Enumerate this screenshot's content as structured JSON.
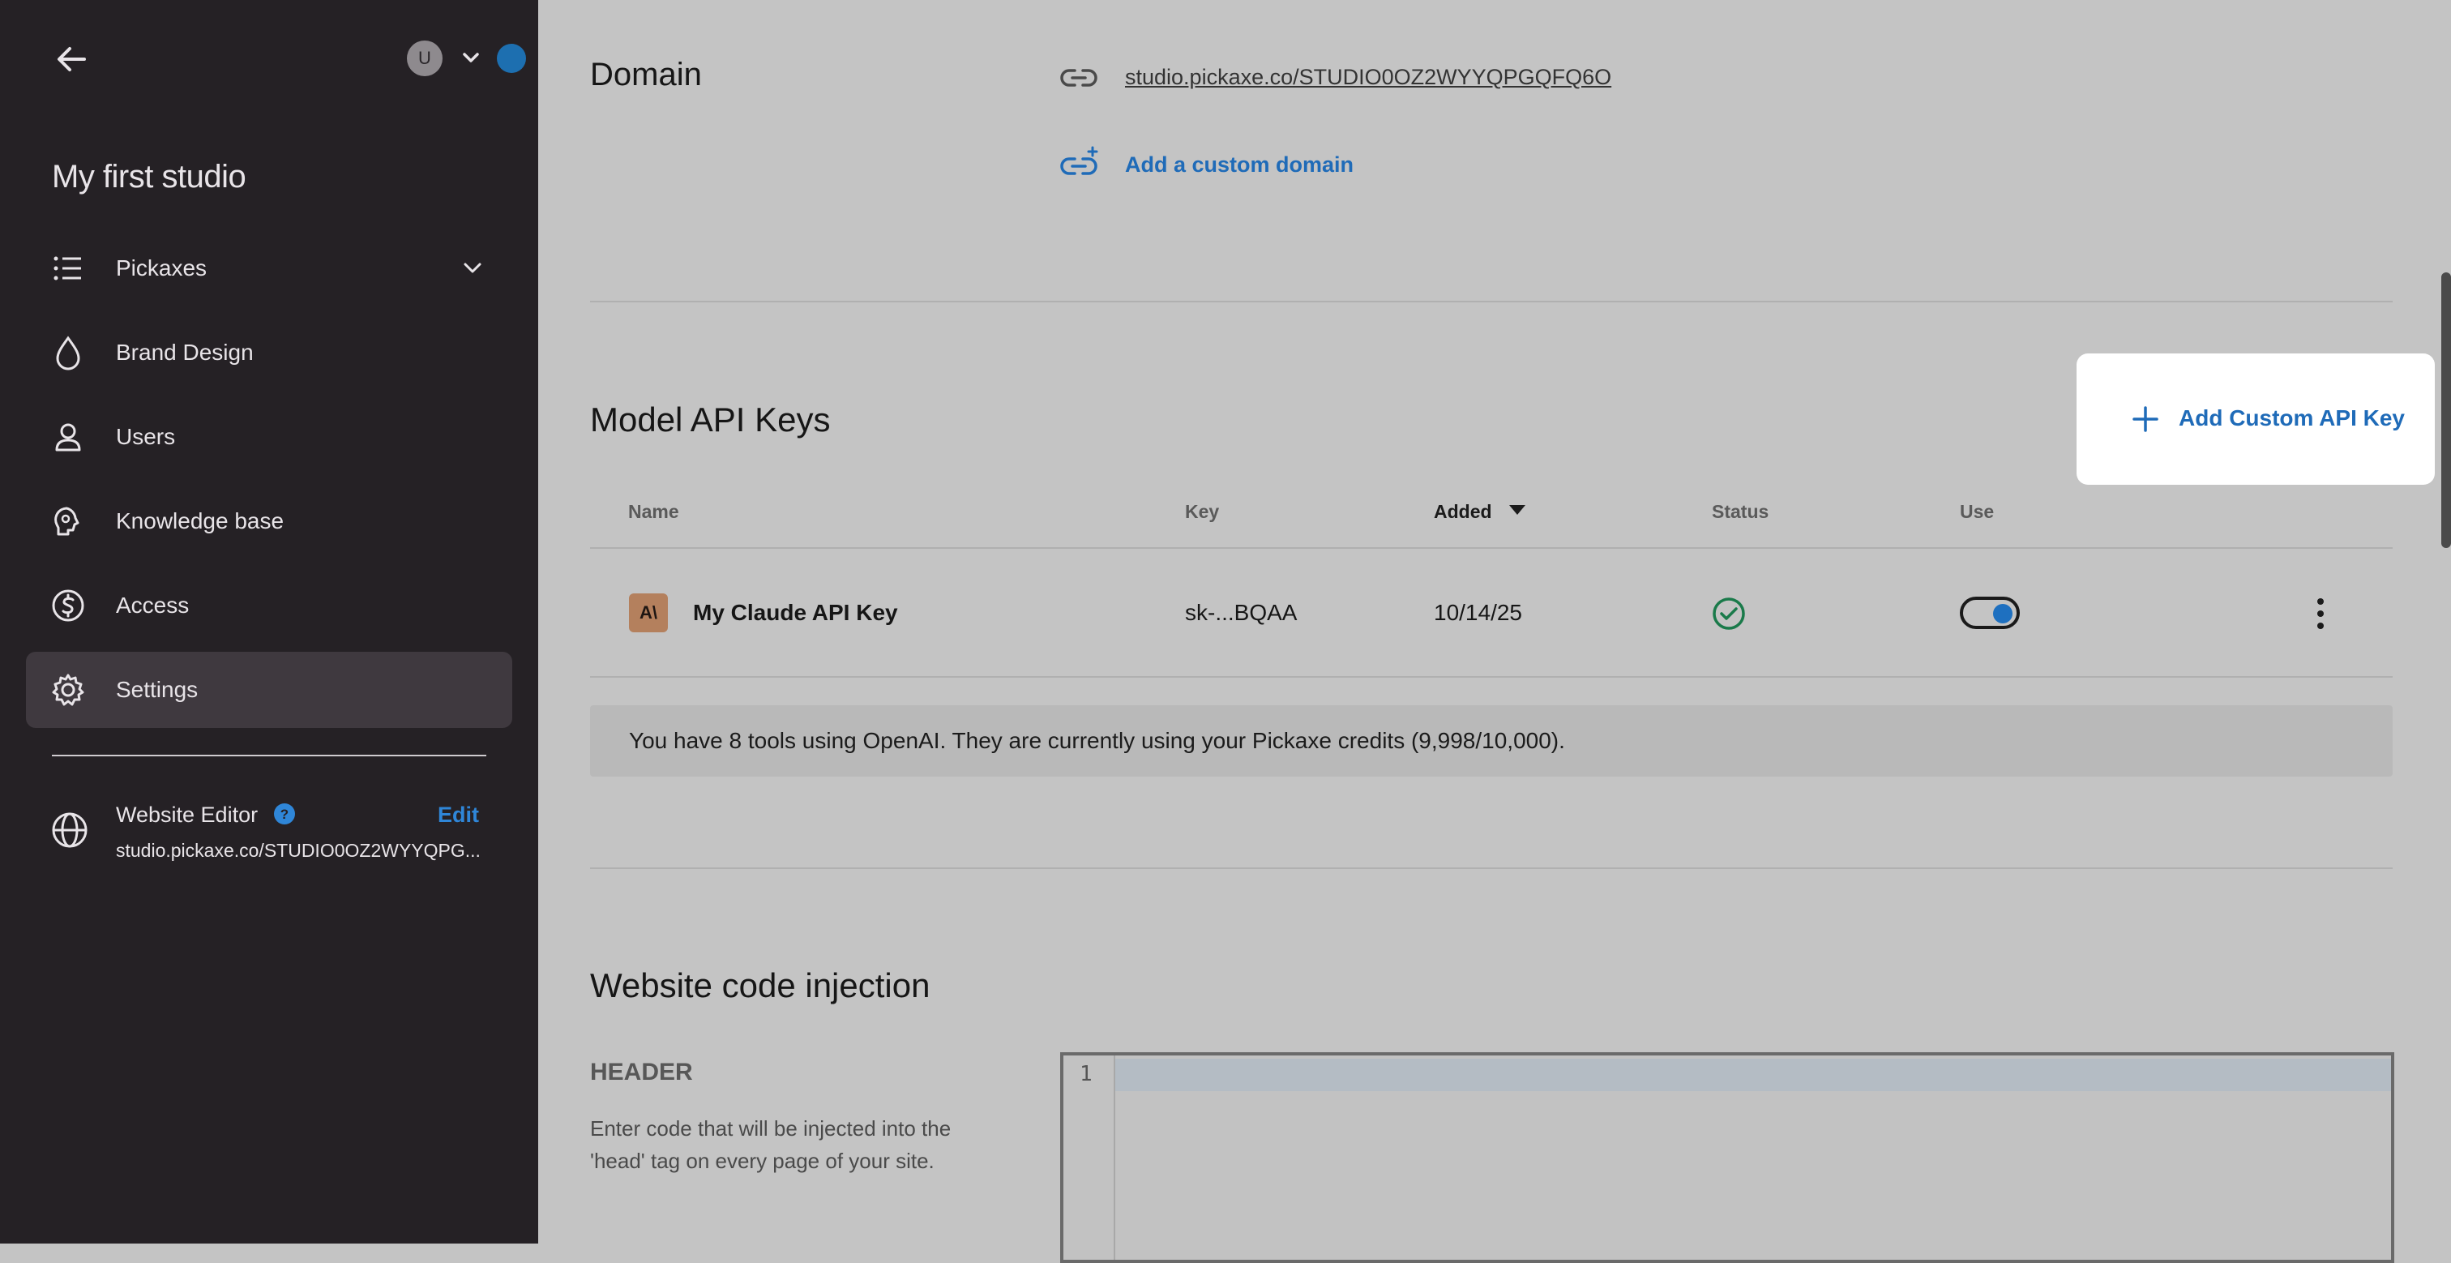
{
  "sidebar": {
    "avatar_initial": "U",
    "studio_title": "My first studio",
    "items": [
      {
        "label": "Pickaxes",
        "icon": "list-icon"
      },
      {
        "label": "Brand Design",
        "icon": "drop-icon"
      },
      {
        "label": "Users",
        "icon": "user-icon"
      },
      {
        "label": "Knowledge base",
        "icon": "brain-icon"
      },
      {
        "label": "Access",
        "icon": "dollar-circle-icon"
      },
      {
        "label": "Settings",
        "icon": "gear-icon",
        "active": true
      }
    ],
    "website_editor": {
      "title": "Website Editor",
      "edit_label": "Edit",
      "url": "studio.pickaxe.co/STUDIO0OZ2WYYQPG..."
    }
  },
  "domain": {
    "heading": "Domain",
    "url": "studio.pickaxe.co/STUDIO0OZ2WYYQPGQFQ6O",
    "add_custom_label": "Add a custom domain"
  },
  "api_keys": {
    "heading": "Model API Keys",
    "add_button_label": "Add Custom API Key",
    "columns": {
      "name": "Name",
      "key": "Key",
      "added": "Added",
      "status": "Status",
      "use": "Use"
    },
    "rows": [
      {
        "logo": "A\\",
        "name": "My Claude API Key",
        "key": "sk-...BQAA",
        "added": "10/14/25",
        "status": "active",
        "use": true
      }
    ],
    "info": "You have 8 tools using OpenAI. They are currently using your Pickaxe credits (9,998/10,000)."
  },
  "code_injection": {
    "heading": "Website code injection",
    "header_label": "HEADER",
    "header_desc": "Enter code that will be injected into the 'head' tag on every page of your site.",
    "line_number": "1"
  },
  "colors": {
    "sidebar_bg": "#252125",
    "main_bg": "#c4c4c4",
    "accent": "#1f6bb8",
    "success": "#1a7a4a"
  }
}
